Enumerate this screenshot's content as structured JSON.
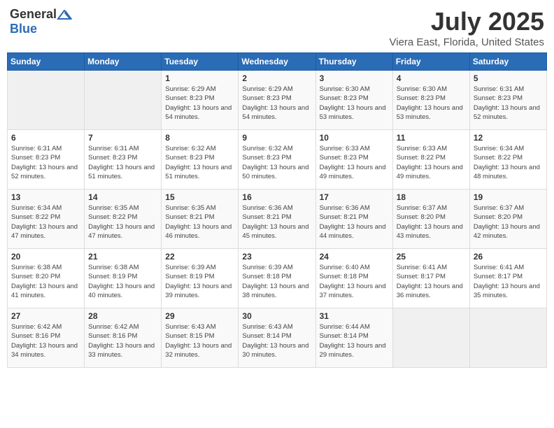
{
  "logo": {
    "general": "General",
    "blue": "Blue"
  },
  "title": {
    "month_year": "July 2025",
    "location": "Viera East, Florida, United States"
  },
  "weekdays": [
    "Sunday",
    "Monday",
    "Tuesday",
    "Wednesday",
    "Thursday",
    "Friday",
    "Saturday"
  ],
  "weeks": [
    [
      {
        "day": "",
        "sunrise": "",
        "sunset": "",
        "daylight": ""
      },
      {
        "day": "",
        "sunrise": "",
        "sunset": "",
        "daylight": ""
      },
      {
        "day": "1",
        "sunrise": "Sunrise: 6:29 AM",
        "sunset": "Sunset: 8:23 PM",
        "daylight": "Daylight: 13 hours and 54 minutes."
      },
      {
        "day": "2",
        "sunrise": "Sunrise: 6:29 AM",
        "sunset": "Sunset: 8:23 PM",
        "daylight": "Daylight: 13 hours and 54 minutes."
      },
      {
        "day": "3",
        "sunrise": "Sunrise: 6:30 AM",
        "sunset": "Sunset: 8:23 PM",
        "daylight": "Daylight: 13 hours and 53 minutes."
      },
      {
        "day": "4",
        "sunrise": "Sunrise: 6:30 AM",
        "sunset": "Sunset: 8:23 PM",
        "daylight": "Daylight: 13 hours and 53 minutes."
      },
      {
        "day": "5",
        "sunrise": "Sunrise: 6:31 AM",
        "sunset": "Sunset: 8:23 PM",
        "daylight": "Daylight: 13 hours and 52 minutes."
      }
    ],
    [
      {
        "day": "6",
        "sunrise": "Sunrise: 6:31 AM",
        "sunset": "Sunset: 8:23 PM",
        "daylight": "Daylight: 13 hours and 52 minutes."
      },
      {
        "day": "7",
        "sunrise": "Sunrise: 6:31 AM",
        "sunset": "Sunset: 8:23 PM",
        "daylight": "Daylight: 13 hours and 51 minutes."
      },
      {
        "day": "8",
        "sunrise": "Sunrise: 6:32 AM",
        "sunset": "Sunset: 8:23 PM",
        "daylight": "Daylight: 13 hours and 51 minutes."
      },
      {
        "day": "9",
        "sunrise": "Sunrise: 6:32 AM",
        "sunset": "Sunset: 8:23 PM",
        "daylight": "Daylight: 13 hours and 50 minutes."
      },
      {
        "day": "10",
        "sunrise": "Sunrise: 6:33 AM",
        "sunset": "Sunset: 8:23 PM",
        "daylight": "Daylight: 13 hours and 49 minutes."
      },
      {
        "day": "11",
        "sunrise": "Sunrise: 6:33 AM",
        "sunset": "Sunset: 8:22 PM",
        "daylight": "Daylight: 13 hours and 49 minutes."
      },
      {
        "day": "12",
        "sunrise": "Sunrise: 6:34 AM",
        "sunset": "Sunset: 8:22 PM",
        "daylight": "Daylight: 13 hours and 48 minutes."
      }
    ],
    [
      {
        "day": "13",
        "sunrise": "Sunrise: 6:34 AM",
        "sunset": "Sunset: 8:22 PM",
        "daylight": "Daylight: 13 hours and 47 minutes."
      },
      {
        "day": "14",
        "sunrise": "Sunrise: 6:35 AM",
        "sunset": "Sunset: 8:22 PM",
        "daylight": "Daylight: 13 hours and 47 minutes."
      },
      {
        "day": "15",
        "sunrise": "Sunrise: 6:35 AM",
        "sunset": "Sunset: 8:21 PM",
        "daylight": "Daylight: 13 hours and 46 minutes."
      },
      {
        "day": "16",
        "sunrise": "Sunrise: 6:36 AM",
        "sunset": "Sunset: 8:21 PM",
        "daylight": "Daylight: 13 hours and 45 minutes."
      },
      {
        "day": "17",
        "sunrise": "Sunrise: 6:36 AM",
        "sunset": "Sunset: 8:21 PM",
        "daylight": "Daylight: 13 hours and 44 minutes."
      },
      {
        "day": "18",
        "sunrise": "Sunrise: 6:37 AM",
        "sunset": "Sunset: 8:20 PM",
        "daylight": "Daylight: 13 hours and 43 minutes."
      },
      {
        "day": "19",
        "sunrise": "Sunrise: 6:37 AM",
        "sunset": "Sunset: 8:20 PM",
        "daylight": "Daylight: 13 hours and 42 minutes."
      }
    ],
    [
      {
        "day": "20",
        "sunrise": "Sunrise: 6:38 AM",
        "sunset": "Sunset: 8:20 PM",
        "daylight": "Daylight: 13 hours and 41 minutes."
      },
      {
        "day": "21",
        "sunrise": "Sunrise: 6:38 AM",
        "sunset": "Sunset: 8:19 PM",
        "daylight": "Daylight: 13 hours and 40 minutes."
      },
      {
        "day": "22",
        "sunrise": "Sunrise: 6:39 AM",
        "sunset": "Sunset: 8:19 PM",
        "daylight": "Daylight: 13 hours and 39 minutes."
      },
      {
        "day": "23",
        "sunrise": "Sunrise: 6:39 AM",
        "sunset": "Sunset: 8:18 PM",
        "daylight": "Daylight: 13 hours and 38 minutes."
      },
      {
        "day": "24",
        "sunrise": "Sunrise: 6:40 AM",
        "sunset": "Sunset: 8:18 PM",
        "daylight": "Daylight: 13 hours and 37 minutes."
      },
      {
        "day": "25",
        "sunrise": "Sunrise: 6:41 AM",
        "sunset": "Sunset: 8:17 PM",
        "daylight": "Daylight: 13 hours and 36 minutes."
      },
      {
        "day": "26",
        "sunrise": "Sunrise: 6:41 AM",
        "sunset": "Sunset: 8:17 PM",
        "daylight": "Daylight: 13 hours and 35 minutes."
      }
    ],
    [
      {
        "day": "27",
        "sunrise": "Sunrise: 6:42 AM",
        "sunset": "Sunset: 8:16 PM",
        "daylight": "Daylight: 13 hours and 34 minutes."
      },
      {
        "day": "28",
        "sunrise": "Sunrise: 6:42 AM",
        "sunset": "Sunset: 8:16 PM",
        "daylight": "Daylight: 13 hours and 33 minutes."
      },
      {
        "day": "29",
        "sunrise": "Sunrise: 6:43 AM",
        "sunset": "Sunset: 8:15 PM",
        "daylight": "Daylight: 13 hours and 32 minutes."
      },
      {
        "day": "30",
        "sunrise": "Sunrise: 6:43 AM",
        "sunset": "Sunset: 8:14 PM",
        "daylight": "Daylight: 13 hours and 30 minutes."
      },
      {
        "day": "31",
        "sunrise": "Sunrise: 6:44 AM",
        "sunset": "Sunset: 8:14 PM",
        "daylight": "Daylight: 13 hours and 29 minutes."
      },
      {
        "day": "",
        "sunrise": "",
        "sunset": "",
        "daylight": ""
      },
      {
        "day": "",
        "sunrise": "",
        "sunset": "",
        "daylight": ""
      }
    ]
  ]
}
